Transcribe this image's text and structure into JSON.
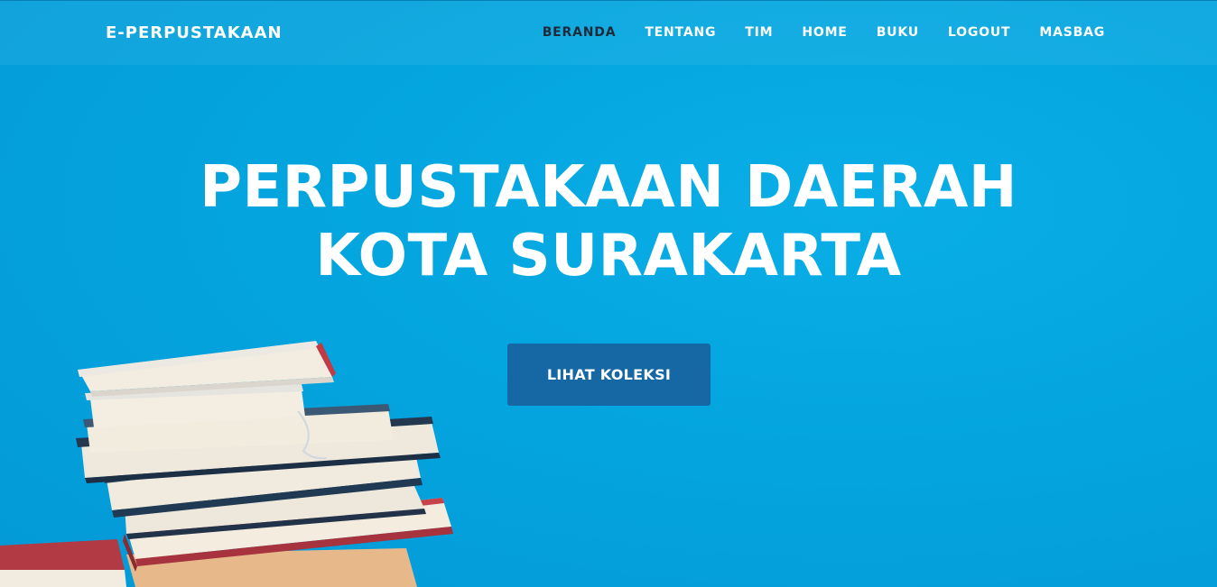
{
  "navbar": {
    "brand": "E-PERPUSTAKAAN",
    "items": [
      {
        "label": "BERANDA",
        "active": true
      },
      {
        "label": "TENTANG",
        "active": false
      },
      {
        "label": "TIM",
        "active": false
      },
      {
        "label": "HOME",
        "active": false
      },
      {
        "label": "BUKU",
        "active": false
      },
      {
        "label": "LOGOUT",
        "active": false
      },
      {
        "label": "MASBAG",
        "active": false
      }
    ]
  },
  "hero": {
    "title_line1": "PERPUSTAKAAN DAERAH",
    "title_line2": "KOTA SURAKARTA",
    "cta_label": "LIHAT KOLEKSI",
    "illustration": "stack-of-books"
  },
  "colors": {
    "background": "#04a5df",
    "button": "#1668a4",
    "active_nav": "#1c2a3a",
    "text": "#ffffff"
  }
}
